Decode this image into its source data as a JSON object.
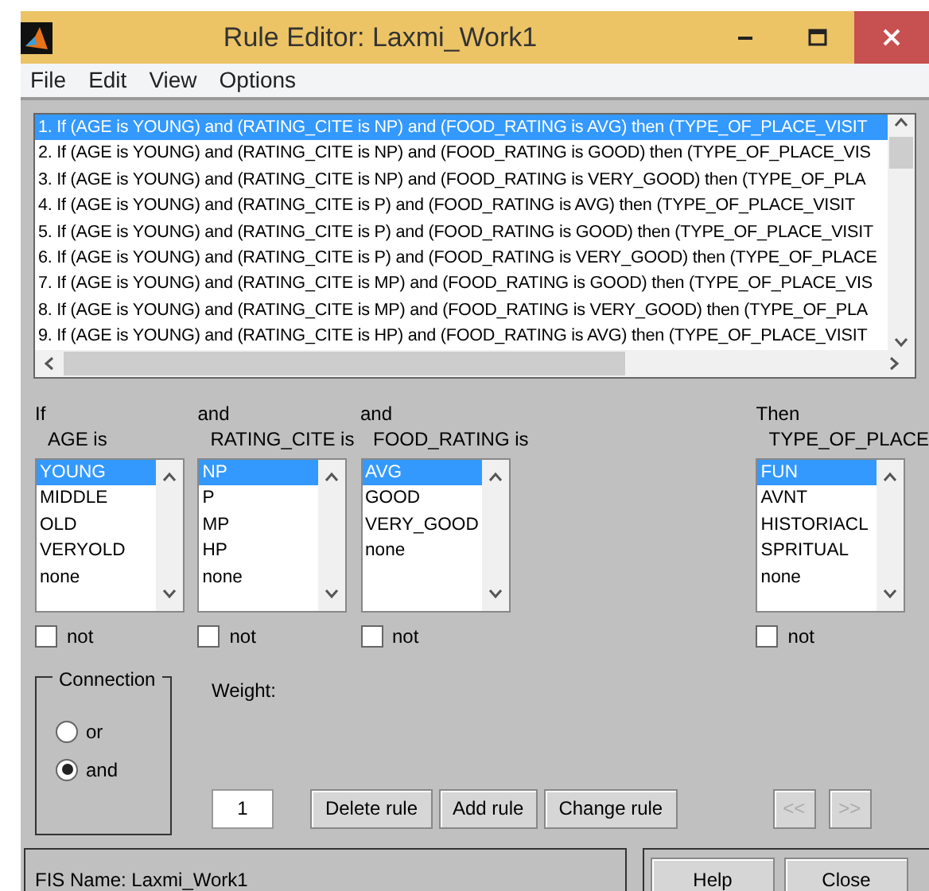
{
  "window": {
    "title": "Rule Editor: Laxmi_Work1"
  },
  "menu": [
    "File",
    "Edit",
    "View",
    "Options"
  ],
  "rules": [
    {
      "text": "1. If (AGE is YOUNG) and (RATING_CITE is NP) and (FOOD_RATING is AVG) then (TYPE_OF_PLACE_VISIT",
      "selected": true
    },
    {
      "text": "2. If (AGE is YOUNG) and (RATING_CITE is NP) and (FOOD_RATING is GOOD) then (TYPE_OF_PLACE_VIS",
      "selected": false
    },
    {
      "text": "3. If (AGE is YOUNG) and (RATING_CITE is NP) and (FOOD_RATING is VERY_GOOD) then (TYPE_OF_PLA",
      "selected": false
    },
    {
      "text": "4. If (AGE is YOUNG) and (RATING_CITE is P) and (FOOD_RATING is AVG) then (TYPE_OF_PLACE_VISIT",
      "selected": false
    },
    {
      "text": "5. If (AGE is YOUNG) and (RATING_CITE is P) and (FOOD_RATING is GOOD) then (TYPE_OF_PLACE_VISIT",
      "selected": false
    },
    {
      "text": "6. If (AGE is YOUNG) and (RATING_CITE is P) and (FOOD_RATING is VERY_GOOD) then (TYPE_OF_PLACE",
      "selected": false
    },
    {
      "text": "7. If (AGE is YOUNG) and (RATING_CITE is MP) and (FOOD_RATING is GOOD) then (TYPE_OF_PLACE_VIS",
      "selected": false
    },
    {
      "text": "8. If (AGE is YOUNG) and (RATING_CITE is MP) and (FOOD_RATING is VERY_GOOD) then (TYPE_OF_PLA",
      "selected": false
    },
    {
      "text": "9. If (AGE is YOUNG) and (RATING_CITE is HP) and (FOOD_RATING is AVG) then (TYPE_OF_PLACE_VISIT",
      "selected": false
    }
  ],
  "variables": [
    {
      "kind": "input",
      "connective": "If",
      "label": "AGE is",
      "not": false,
      "not_label": "not",
      "options": [
        {
          "label": "YOUNG",
          "selected": true
        },
        {
          "label": "MIDDLE",
          "selected": false
        },
        {
          "label": "OLD",
          "selected": false
        },
        {
          "label": "VERYOLD",
          "selected": false
        },
        {
          "label": "none",
          "selected": false
        }
      ]
    },
    {
      "kind": "input",
      "connective": "and",
      "label": "RATING_CITE is",
      "not": false,
      "not_label": "not",
      "options": [
        {
          "label": "NP",
          "selected": true
        },
        {
          "label": "P",
          "selected": false
        },
        {
          "label": "MP",
          "selected": false
        },
        {
          "label": "HP",
          "selected": false
        },
        {
          "label": "none",
          "selected": false
        }
      ]
    },
    {
      "kind": "input",
      "connective": "and",
      "label": "FOOD_RATING is",
      "not": false,
      "not_label": "not",
      "options": [
        {
          "label": "AVG",
          "selected": true
        },
        {
          "label": "GOOD",
          "selected": false
        },
        {
          "label": "VERY_GOOD",
          "selected": false
        },
        {
          "label": "none",
          "selected": false
        }
      ]
    },
    {
      "kind": "output",
      "connective": "Then",
      "label": "TYPE_OF_PLACE",
      "not": false,
      "not_label": "not",
      "options": [
        {
          "label": "FUN",
          "selected": true
        },
        {
          "label": "AVNT",
          "selected": false
        },
        {
          "label": "HISTORIACL",
          "selected": false
        },
        {
          "label": "SPRITUAL",
          "selected": false
        },
        {
          "label": "none",
          "selected": false
        }
      ]
    }
  ],
  "connection": {
    "title": "Connection",
    "options": [
      {
        "label": "or",
        "selected": false
      },
      {
        "label": "and",
        "selected": true
      }
    ]
  },
  "weight": {
    "label": "Weight:",
    "value": "1"
  },
  "rule_buttons": [
    {
      "label": "Delete rule",
      "disabled": false
    },
    {
      "label": "Add rule",
      "disabled": false
    },
    {
      "label": "Change rule",
      "disabled": false
    }
  ],
  "nav_buttons": [
    {
      "label": "<<",
      "disabled": true
    },
    {
      "label": ">>",
      "disabled": true
    }
  ],
  "status": "FIS Name: Laxmi_Work1",
  "bottom_buttons": [
    "Help",
    "Close"
  ]
}
